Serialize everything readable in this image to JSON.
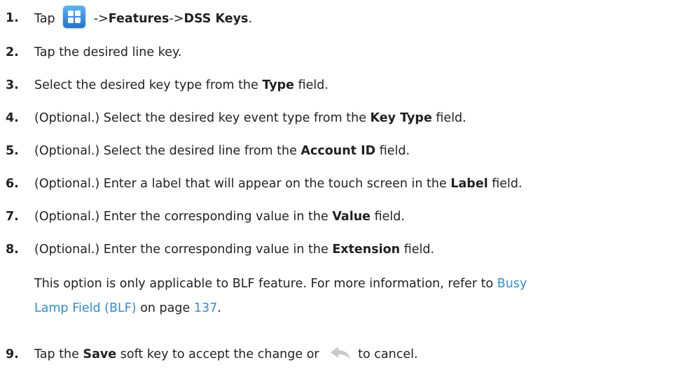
{
  "steps": [
    {
      "num": "1.",
      "pre": "Tap",
      "arrow1": "->",
      "features": "Features",
      "arrow2": "->",
      "dss": "DSS Keys",
      "end": "."
    },
    {
      "num": "2.",
      "text": "Tap the desired line key."
    },
    {
      "num": "3.",
      "pre": "Select the desired key type from the ",
      "bold": "Type",
      "post": " field."
    },
    {
      "num": "4.",
      "pre": "(Optional.) Select the desired key event type from the ",
      "bold": "Key Type",
      "post": " field."
    },
    {
      "num": "5.",
      "pre": "(Optional.) Select the desired line from the ",
      "bold": "Account ID",
      "post": " field."
    },
    {
      "num": "6.",
      "pre": "(Optional.) Enter a label that will appear on the touch screen in the ",
      "bold": "Label",
      "post": " field."
    },
    {
      "num": "7.",
      "pre": "(Optional.) Enter the corresponding value in the ",
      "bold": "Value",
      "post": " field."
    },
    {
      "num": "8.",
      "pre": "(Optional.) Enter the corresponding value in the ",
      "bold": "Extension",
      "post": " field."
    },
    {
      "num": "9.",
      "pre": "Tap the ",
      "bold": "Save",
      "mid": " soft key to accept the change or ",
      "post": "to cancel."
    }
  ],
  "note": {
    "line1_text": "This option is only applicable to BLF feature. For more information, refer to ",
    "line1_link": "Busy",
    "line2_link": "Lamp Field (BLF)",
    "line2_mid": " on page ",
    "page_link": "137",
    "line2_end": "."
  },
  "icons": {
    "menu": "menu-grid-icon",
    "back": "back-arrow-icon"
  },
  "colors": {
    "text": "#231f20",
    "link": "#3a8cc6",
    "icon_blue": "#1f73cf",
    "back_gray": "#c9c9c9"
  }
}
